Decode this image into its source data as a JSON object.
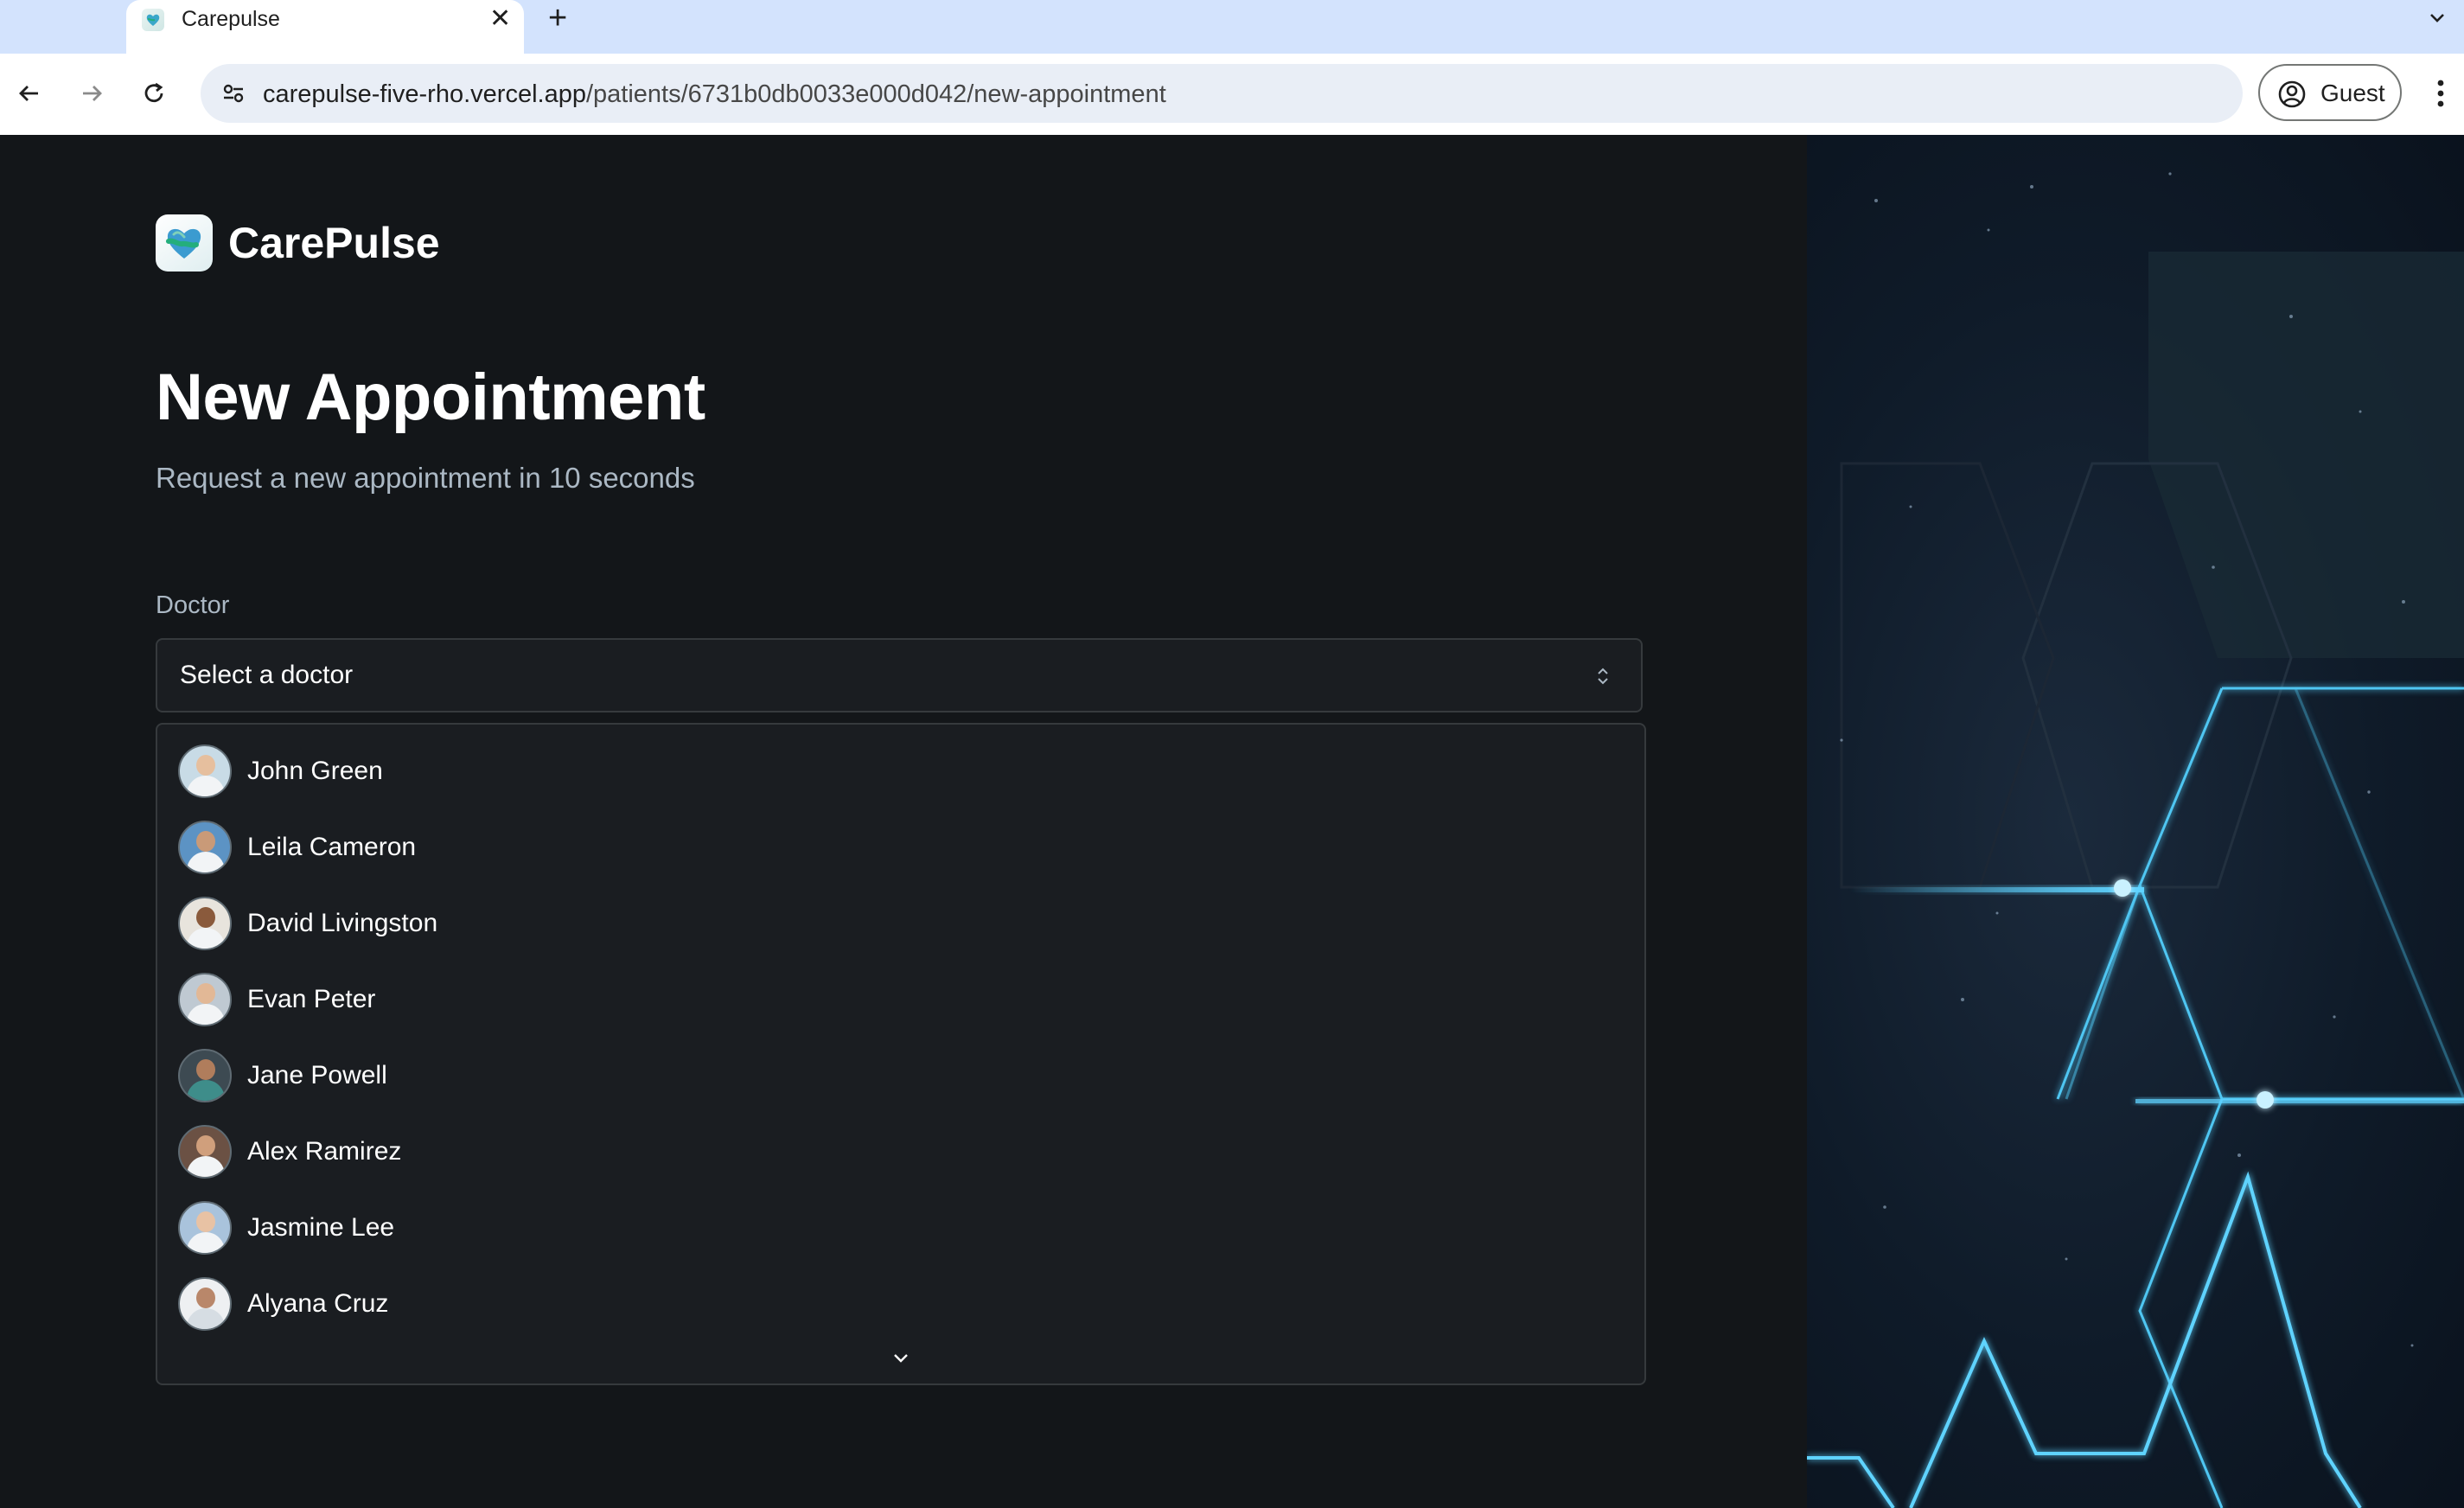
{
  "browser": {
    "tab_title": "Carepulse",
    "tab_favicon": "carepulse-logo-icon",
    "url_domain": "carepulse-five-rho.vercel.app",
    "url_path": "/patients/6731b0db0033e000d042/new-appointment",
    "profile_label": "Guest"
  },
  "app": {
    "brand": "CarePulse",
    "title": "New Appointment",
    "subtitle": "Request a new appointment in 10 seconds"
  },
  "form": {
    "doctor_label": "Doctor",
    "doctor_placeholder": "Select a doctor",
    "doctors": [
      {
        "name": "John Green"
      },
      {
        "name": "Leila Cameron"
      },
      {
        "name": "David Livingston"
      },
      {
        "name": "Evan Peter"
      },
      {
        "name": "Jane Powell"
      },
      {
        "name": "Alex Ramirez"
      },
      {
        "name": "Jasmine Lee"
      },
      {
        "name": "Alyana Cruz"
      }
    ]
  },
  "colors": {
    "page_bg": "#131619",
    "input_bg": "#1a1d21",
    "border": "#363a3d",
    "muted_text": "#abb8c4",
    "accent": "#24ae7c",
    "glow": "#5fd3ff"
  }
}
